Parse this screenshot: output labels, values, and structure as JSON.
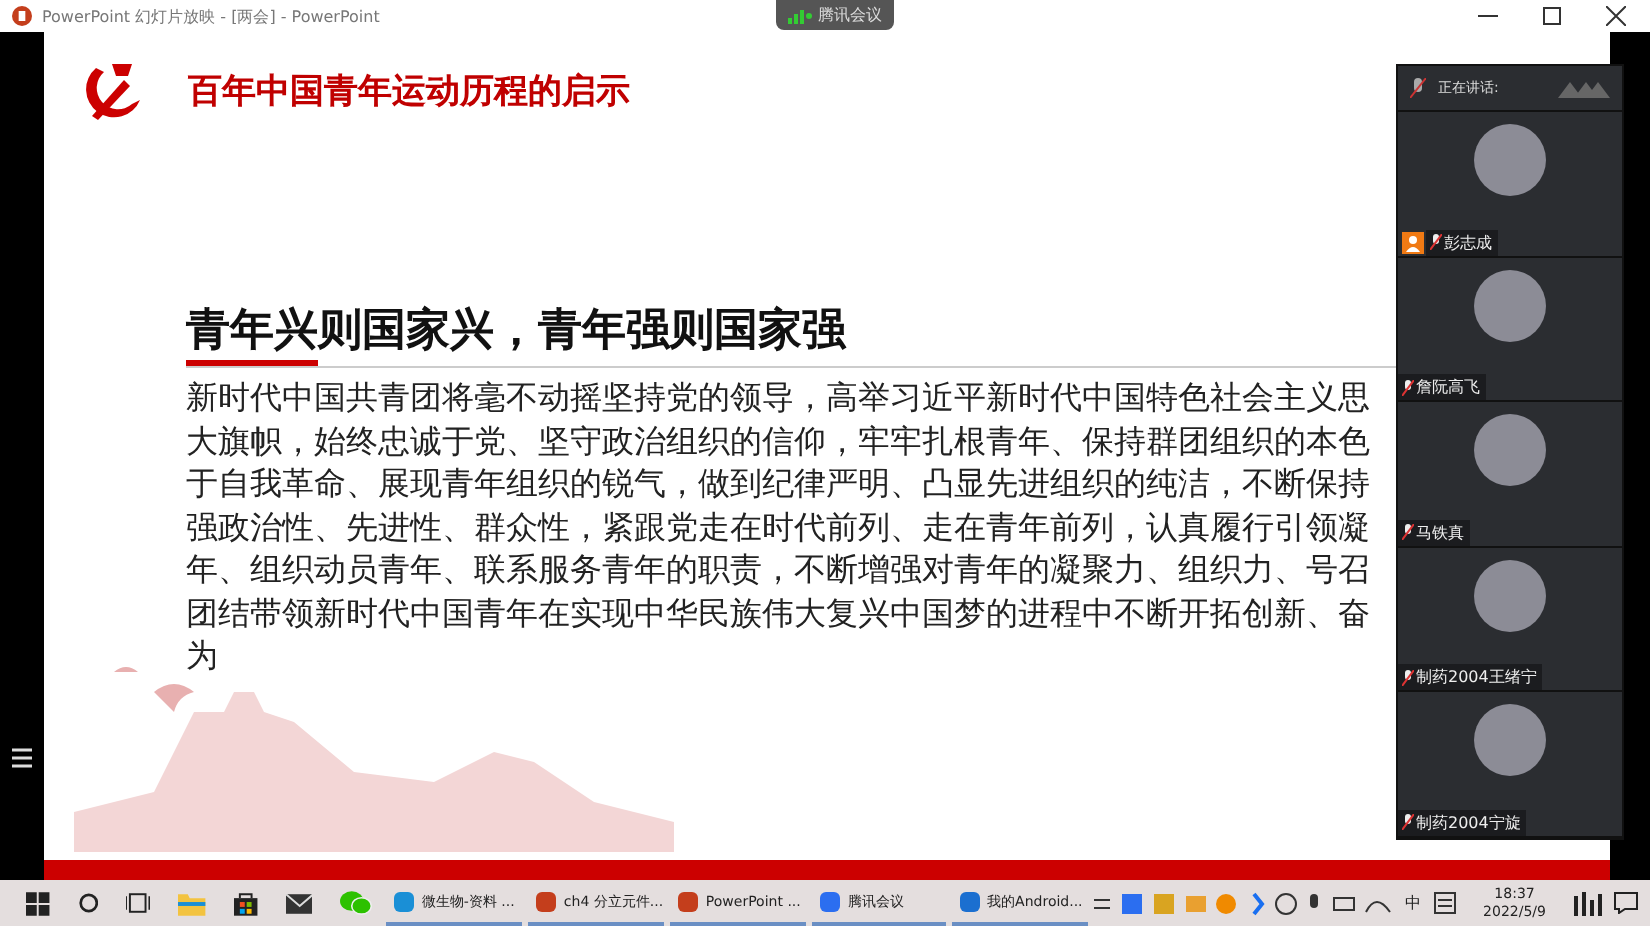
{
  "window": {
    "title": "PowerPoint 幻灯片放映 - [两会] - PowerPoint",
    "meeting_tab": "腾讯会议"
  },
  "slide": {
    "header": "百年中国青年运动历程的启示",
    "heading": "青年兴则国家兴，青年强则国家强",
    "body_lines": [
      "新时代中国共青团将毫不动摇坚持党的领导，高举习近平新时代中国特色社会主义思",
      "大旗帜，始终忠诚于党、坚守政治组织的信仰，牢牢扎根青年、保持群团组织的本色",
      "于自我革命、展现青年组织的锐气，做到纪律严明、凸显先进组织的纯洁，不断保持",
      "强政治性、先进性、群众性，紧跟党走在时代前列、走在青年前列，认真履行引领凝",
      "年、组织动员青年、联系服务青年的职责，不断增强对青年的凝聚力、组织力、号召",
      "团结带领新时代中国青年在实现中华民族伟大复兴中国梦的进程中不断开拓创新、奋",
      "为"
    ]
  },
  "meeting": {
    "speaking_label": "正在讲话:",
    "participants": [
      {
        "name": "彭志成",
        "host": true
      },
      {
        "name": "詹阮高飞",
        "host": false
      },
      {
        "name": "马铁真",
        "host": false
      },
      {
        "name": "制药2004王绪宁",
        "host": false
      },
      {
        "name": "制药2004宁旋",
        "host": false
      }
    ]
  },
  "taskbar": {
    "apps": [
      {
        "label": "微生物-资料 ...",
        "kind": "edge"
      },
      {
        "label": "ch4 分立元件...",
        "kind": "ppt"
      },
      {
        "label": "PowerPoint ...",
        "kind": "ppt"
      },
      {
        "label": "腾讯会议",
        "kind": "meeting"
      },
      {
        "label": "我的Android...",
        "kind": "phone"
      }
    ],
    "ime": "中",
    "time": "18:37",
    "date": "2022/5/9"
  }
}
